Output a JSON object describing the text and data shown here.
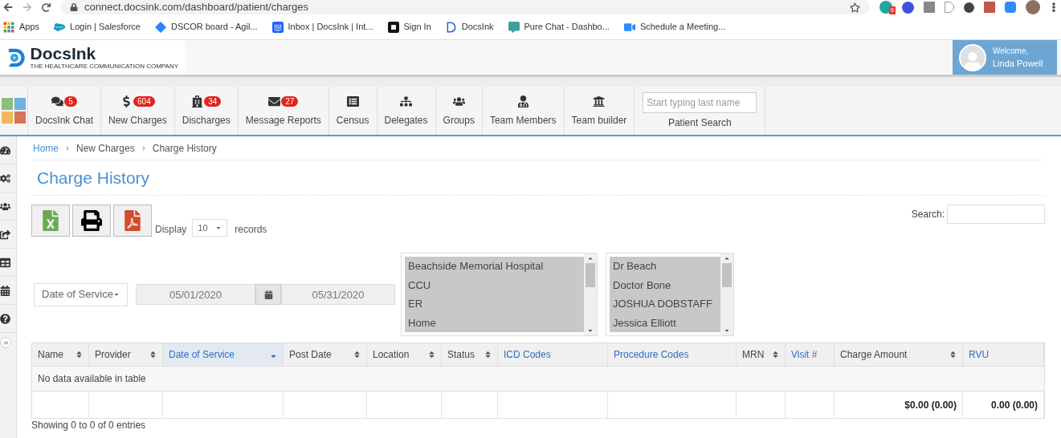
{
  "browser": {
    "url": "connect.docsink.com/dashboard/patient/charges",
    "extension_badge": "9",
    "bookmarks": [
      {
        "label": "Apps"
      },
      {
        "label": "Login | Salesforce"
      },
      {
        "label": "DSCOR board - Agil..."
      },
      {
        "label": "Inbox | DocsInk | Int..."
      },
      {
        "label": "Sign In"
      },
      {
        "label": "DocsInk"
      },
      {
        "label": "Pure Chat - Dashbo..."
      },
      {
        "label": "Schedule a Meeting..."
      }
    ]
  },
  "header": {
    "logo_name": "DocsInk",
    "logo_tagline": "THE HEALTHCARE COMMUNICATION COMPANY",
    "welcome": "Welcome,",
    "user": "Linda Powell"
  },
  "nav": [
    {
      "label": "DocsInk Chat",
      "badge": "5"
    },
    {
      "label": "New Charges",
      "badge": "604"
    },
    {
      "label": "Discharges",
      "badge": "34"
    },
    {
      "label": "Message Reports",
      "badge": "27"
    },
    {
      "label": "Census"
    },
    {
      "label": "Delegates"
    },
    {
      "label": "Groups"
    },
    {
      "label": "Team Members"
    },
    {
      "label": "Team builder"
    }
  ],
  "patient_search": {
    "placeholder": "Start typing last name",
    "label": "Patient Search"
  },
  "breadcrumb": [
    {
      "label": "Home",
      "kind": "link"
    },
    {
      "label": "New Charges",
      "kind": "text"
    },
    {
      "label": "Charge History",
      "kind": "text"
    }
  ],
  "title": "Charge History",
  "display": {
    "before": "Display",
    "value": "10",
    "after": "records"
  },
  "search_label": "Search:",
  "filters": {
    "date_type": "Date of Service",
    "date_from": "05/01/2020",
    "date_to": "05/31/2020",
    "locations": [
      {
        "label": "Beachside Memorial Hospital",
        "selected": true
      },
      {
        "label": "CCU",
        "selected": true
      },
      {
        "label": "ER",
        "selected": true
      },
      {
        "label": "Home",
        "selected": true
      }
    ],
    "providers": [
      {
        "label": "Dr Beach",
        "selected": true
      },
      {
        "label": "Doctor Bone",
        "selected": true
      },
      {
        "label": "JOSHUA DOBSTAFF",
        "selected": true
      },
      {
        "label": "Jessica Elliott",
        "selected": true
      }
    ]
  },
  "table": {
    "columns": [
      {
        "label": "Name",
        "kind": "sortable"
      },
      {
        "label": "Provider",
        "kind": "sortable"
      },
      {
        "label": "Date of Service",
        "kind": "sorted"
      },
      {
        "label": "Post Date",
        "kind": "sortable"
      },
      {
        "label": "Location",
        "kind": "sortable"
      },
      {
        "label": "Status",
        "kind": "sortable"
      },
      {
        "label": "ICD Codes",
        "kind": "link"
      },
      {
        "label": "Procedure Codes",
        "kind": "link"
      },
      {
        "label": "MRN",
        "kind": "sortable"
      },
      {
        "label": "Visit #",
        "kind": "link"
      },
      {
        "label": "Charge Amount",
        "kind": "sortable",
        "total": "$0.00 (0.00)"
      },
      {
        "label": "RVU",
        "kind": "link",
        "total": "0.00 (0.00)"
      }
    ],
    "empty_message": "No data available in table",
    "info": "Showing 0 to 0 of 0 entries"
  }
}
